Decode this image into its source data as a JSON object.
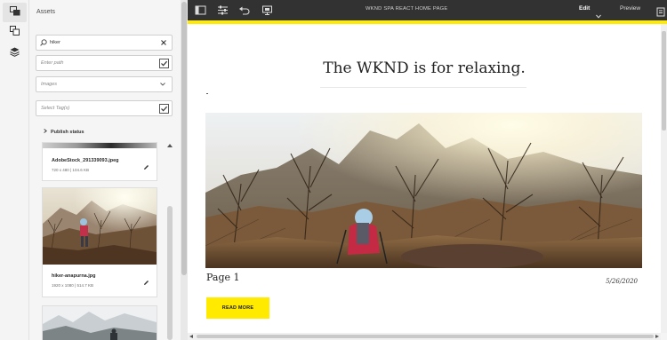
{
  "rail": {
    "items": [
      {
        "icon": "asset-finder-icon",
        "active": true
      },
      {
        "icon": "components-icon",
        "active": false
      },
      {
        "icon": "content-tree-icon",
        "active": false
      }
    ]
  },
  "assets_panel": {
    "title": "Assets",
    "search": {
      "value": "hiker",
      "clear_icon": "close-icon"
    },
    "path_field": {
      "placeholder": "Enter path"
    },
    "type_select": {
      "value": "Images",
      "icon": "chevron-down-icon"
    },
    "tag_field": {
      "placeholder": "Select Tag(s)"
    },
    "publish_status": {
      "label": "Publish status"
    },
    "assets": [
      {
        "name": "AdobeStock_291339093.jpeg",
        "meta": "720 x 480 | 104.6 KB"
      },
      {
        "name": "hiker-anapurna.jpg",
        "meta": "1920 x 1080 | 514.7 KB"
      },
      {
        "name": "",
        "meta": ""
      }
    ]
  },
  "topbar": {
    "page_title": "WKND SPA REACT HOME PAGE",
    "mode_label": "Edit",
    "preview_label": "Preview",
    "accent_color": "#ffea00"
  },
  "page": {
    "headline": "The WKND is for relaxing.",
    "card": {
      "title": "Page 1",
      "date": "5/26/2020",
      "button_label": "READ MORE"
    }
  }
}
